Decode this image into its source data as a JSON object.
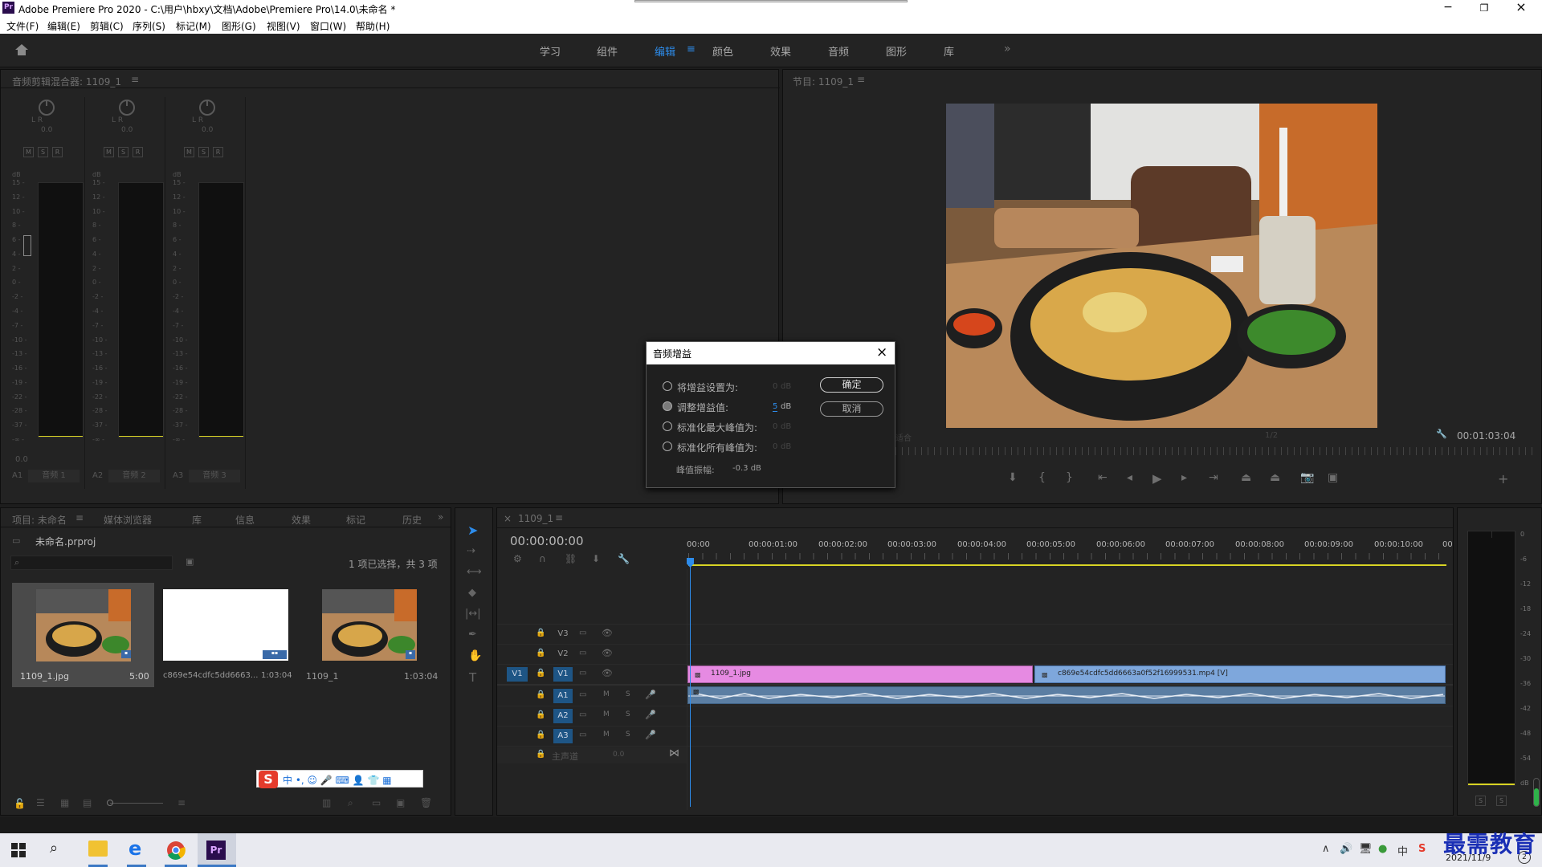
{
  "window": {
    "title": "Adobe Premiere Pro 2020 - C:\\用户\\hbxy\\文档\\Adobe\\Premiere Pro\\14.0\\未命名 *",
    "app_badge": "Pr"
  },
  "menu": [
    "文件(F)",
    "编辑(E)",
    "剪辑(C)",
    "序列(S)",
    "标记(M)",
    "图形(G)",
    "视图(V)",
    "窗口(W)",
    "帮助(H)"
  ],
  "workspaces": [
    "学习",
    "组件",
    "编辑",
    "颜色",
    "效果",
    "音频",
    "图形",
    "库"
  ],
  "active_workspace": "编辑",
  "more": "»",
  "mixer": {
    "title": "音频剪辑混合器: 1109_1",
    "menu_glyph": "≡",
    "lr": "L R",
    "knob_value": "0.0",
    "msr": [
      "M",
      "S",
      "R"
    ],
    "db_label": "dB",
    "scale": [
      "15",
      "12",
      "10",
      "8",
      "6",
      "4",
      "2",
      "0",
      "-2",
      "-4",
      "-7",
      "-10",
      "-13",
      "-16",
      "-19",
      "-22",
      "-28",
      "-37",
      "-∞"
    ],
    "bottom_value": "0.0",
    "channels": [
      {
        "id": "A1",
        "name": "音频 1"
      },
      {
        "id": "A2",
        "name": "音频 2"
      },
      {
        "id": "A3",
        "name": "音频 3"
      }
    ]
  },
  "program": {
    "title": "节目: 1109_1",
    "menu_glyph": "≡",
    "fit_label": "适合",
    "res": "1/2",
    "timecode": "00:01:03:04"
  },
  "dialog": {
    "title": "音频增益",
    "options": [
      {
        "label": "将增益设置为:",
        "value": "0",
        "unit": "dB",
        "selected": false
      },
      {
        "label": "调整增益值:",
        "value": "5",
        "unit": "dB",
        "selected": true
      },
      {
        "label": "标准化最大峰值为:",
        "value": "0",
        "unit": "dB",
        "selected": false
      },
      {
        "label": "标准化所有峰值为:",
        "value": "0",
        "unit": "dB",
        "selected": false
      }
    ],
    "peak_label": "峰值振幅:",
    "peak_value": "-0.3 dB",
    "ok": "确定",
    "cancel": "取消"
  },
  "project": {
    "tabs": [
      "项目: 未命名",
      "媒体浏览器",
      "库",
      "信息",
      "效果",
      "标记",
      "历史"
    ],
    "more": "»",
    "file": "未命名.prproj",
    "status": "1 项已选择，共 3 项",
    "items": [
      {
        "name": "1109_1.jpg",
        "duration": "5:00",
        "kind": "photo"
      },
      {
        "name": "c869e54cdfc5dd6663...",
        "duration": "1:03:04",
        "kind": "white"
      },
      {
        "name": "1109_1",
        "duration": "1:03:04",
        "kind": "photo"
      }
    ]
  },
  "ime": {
    "logo": "S",
    "text": "中 •, ☺ 🎤 ⌨ 👤 👕 ▦"
  },
  "timeline": {
    "tab": "1109_1",
    "menu_glyph": "≡",
    "close": "×",
    "timecode": "00:00:00:00",
    "ruler": [
      "00:00",
      "00:00:01:00",
      "00:00:02:00",
      "00:00:03:00",
      "00:00:04:00",
      "00:00:05:00",
      "00:00:06:00",
      "00:00:07:00",
      "00:00:08:00",
      "00:00:09:00",
      "00:00:10:00",
      "00"
    ],
    "video_tracks": [
      "V3",
      "V2",
      "V1"
    ],
    "audio_tracks": [
      "A1",
      "A2",
      "A3"
    ],
    "source_patch": "V1",
    "master": "主声道",
    "master_value": "0.0",
    "clips": {
      "v1_a": "1109_1.jpg",
      "v1_b": "c869e54cdfc5dd6663a0f52f16999531.mp4 [V]"
    },
    "track_m": "M",
    "track_s": "S"
  },
  "meter": {
    "scale": [
      "0",
      "-6",
      "-12",
      "-18",
      "-24",
      "-30",
      "-36",
      "-42",
      "-48",
      "-54",
      "dB"
    ],
    "solo": [
      "S",
      "S"
    ]
  },
  "taskbar": {
    "pr": "Pr",
    "date": "2021/11/9",
    "num": "2"
  },
  "watermark": "最需教育",
  "colors": {
    "accent": "#2d8ceb",
    "clip_pink": "#e389e0",
    "clip_blue": "#7ea7dc",
    "playhead": "#2d8ceb",
    "yellow": "#d8d324"
  }
}
